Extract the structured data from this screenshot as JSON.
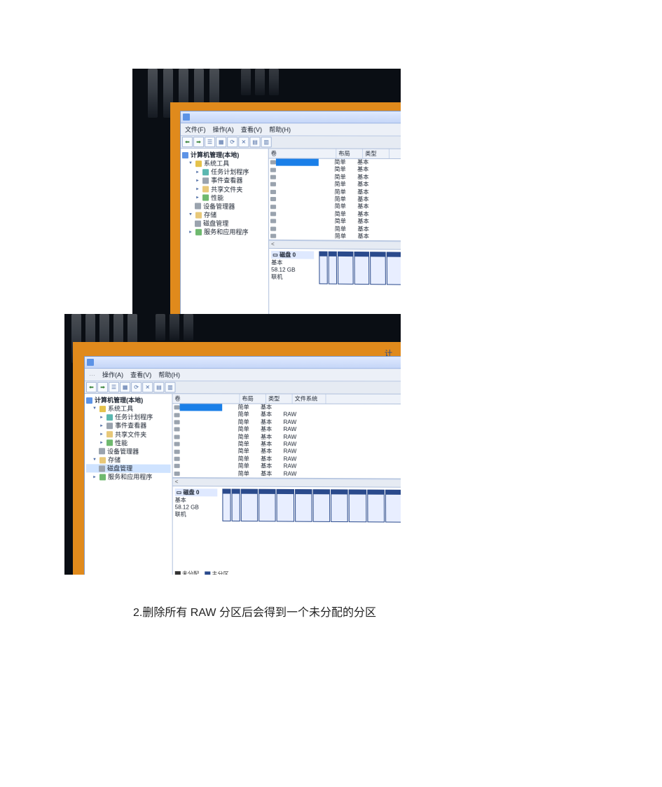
{
  "menubar": {
    "file": "文件(F)",
    "action": "操作(A)",
    "view": "查看(V)",
    "help": "帮助(H)"
  },
  "tree": {
    "root": "计算机管理(本地)",
    "sys_tools": "系统工具",
    "task_scheduler": "任务计划程序",
    "event_viewer": "事件查看器",
    "shared_folders": "共享文件夹",
    "performance": "性能",
    "device_manager": "设备管理器",
    "storage": "存储",
    "disk_management": "磁盘管理",
    "services_apps": "服务和应用程序"
  },
  "columns": {
    "volume": "卷",
    "layout": "布局",
    "type": "类型",
    "filesystem": "文件系统"
  },
  "volume_rows_a": [
    {
      "layout": "简单",
      "type": "基本"
    },
    {
      "layout": "简单",
      "type": "基本"
    },
    {
      "layout": "简单",
      "type": "基本"
    },
    {
      "layout": "简单",
      "type": "基本"
    },
    {
      "layout": "简单",
      "type": "基本"
    },
    {
      "layout": "简单",
      "type": "基本"
    },
    {
      "layout": "简单",
      "type": "基本"
    },
    {
      "layout": "简单",
      "type": "基本"
    },
    {
      "layout": "简单",
      "type": "基本"
    },
    {
      "layout": "简单",
      "type": "基本"
    },
    {
      "layout": "简单",
      "type": "基本"
    }
  ],
  "volume_rows_b": [
    {
      "layout": "简单",
      "type": "基本",
      "fs": ""
    },
    {
      "layout": "简单",
      "type": "基本",
      "fs": "RAW"
    },
    {
      "layout": "简单",
      "type": "基本",
      "fs": "RAW"
    },
    {
      "layout": "简单",
      "type": "基本",
      "fs": "RAW"
    },
    {
      "layout": "简单",
      "type": "基本",
      "fs": "RAW"
    },
    {
      "layout": "简单",
      "type": "基本",
      "fs": "RAW"
    },
    {
      "layout": "简单",
      "type": "基本",
      "fs": "RAW"
    },
    {
      "layout": "简单",
      "type": "基本",
      "fs": "RAW"
    },
    {
      "layout": "简单",
      "type": "基本",
      "fs": "RAW"
    },
    {
      "layout": "简单",
      "type": "基本",
      "fs": "RAW"
    }
  ],
  "disk": {
    "title": "磁盘 0",
    "basic": "基本",
    "size": "58.12 GB",
    "status": "联机"
  },
  "legend": {
    "unallocated": "未分配",
    "primary": "主分区"
  },
  "win_title_partial": "计",
  "scroll_hint": "<",
  "caption": "2.删除所有 RAW 分区后会得到一个未分配的分区"
}
